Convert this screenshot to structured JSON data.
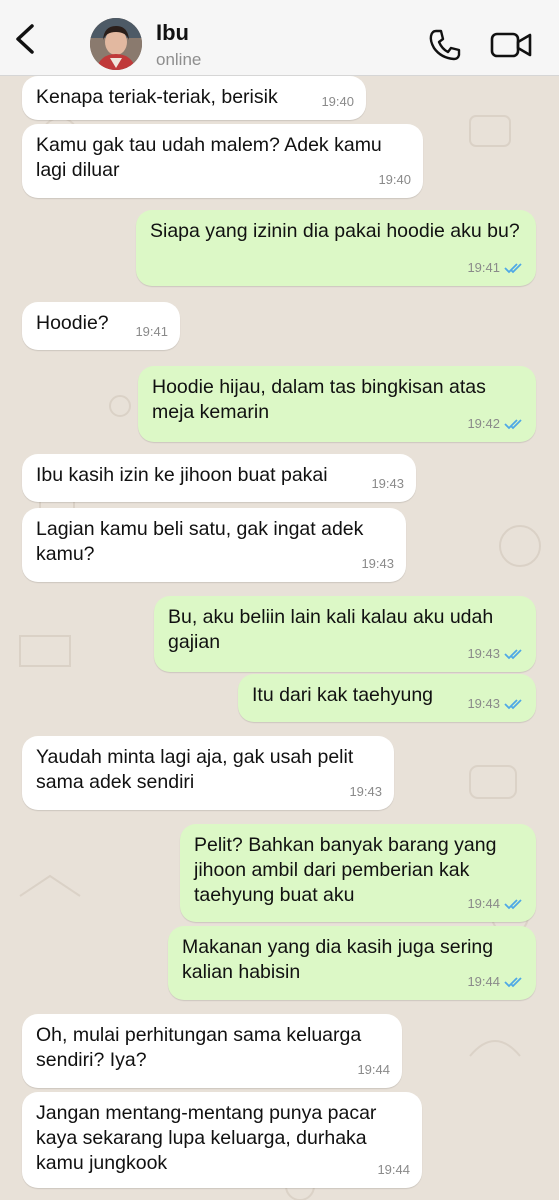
{
  "contact": {
    "name": "Ibu",
    "status": "online"
  },
  "icons": {
    "back": "chevron-left-icon",
    "call": "phone-icon",
    "video": "video-camera-icon",
    "read_receipt": "double-check-icon"
  },
  "colors": {
    "incoming_bubble": "#ffffff",
    "outgoing_bubble": "#dcf8c6",
    "read_tick": "#4fa8e6",
    "wallpaper": "#e8e1d8"
  },
  "messages": [
    {
      "side": "in",
      "text": "Kenapa teriak-teriak, berisik",
      "time": "19:40"
    },
    {
      "side": "in",
      "text": "Kamu gak tau udah malem? Adek kamu lagi diluar",
      "time": "19:40"
    },
    {
      "side": "out",
      "text": "Siapa yang izinin dia pakai hoodie aku bu?",
      "time": "19:41",
      "read": true
    },
    {
      "side": "in",
      "text": "Hoodie?",
      "time": "19:41"
    },
    {
      "side": "out",
      "text": "Hoodie hijau, dalam tas bingkisan atas meja kemarin",
      "time": "19:42",
      "read": true
    },
    {
      "side": "in",
      "text": "Ibu kasih izin ke jihoon buat pakai",
      "time": "19:43"
    },
    {
      "side": "in",
      "text": "Lagian kamu beli satu, gak ingat adek kamu?",
      "time": "19:43"
    },
    {
      "side": "out",
      "text": "Bu, aku beliin lain kali kalau aku udah gajian",
      "time": "19:43",
      "read": true
    },
    {
      "side": "out",
      "text": "Itu dari kak taehyung",
      "time": "19:43",
      "read": true
    },
    {
      "side": "in",
      "text": "Yaudah minta lagi aja, gak usah pelit sama adek sendiri",
      "time": "19:43"
    },
    {
      "side": "out",
      "text": "Pelit? Bahkan banyak barang yang jihoon ambil dari pemberian kak taehyung buat aku",
      "time": "19:44",
      "read": true
    },
    {
      "side": "out",
      "text": "Makanan yang dia kasih juga sering kalian habisin",
      "time": "19:44",
      "read": true
    },
    {
      "side": "in",
      "text": "Oh, mulai perhitungan sama keluarga sendiri? Iya?",
      "time": "19:44"
    },
    {
      "side": "in",
      "text": "Jangan mentang-mentang punya pacar kaya sekarang lupa keluarga, durhaka kamu jungkook",
      "time": "19:44"
    }
  ]
}
